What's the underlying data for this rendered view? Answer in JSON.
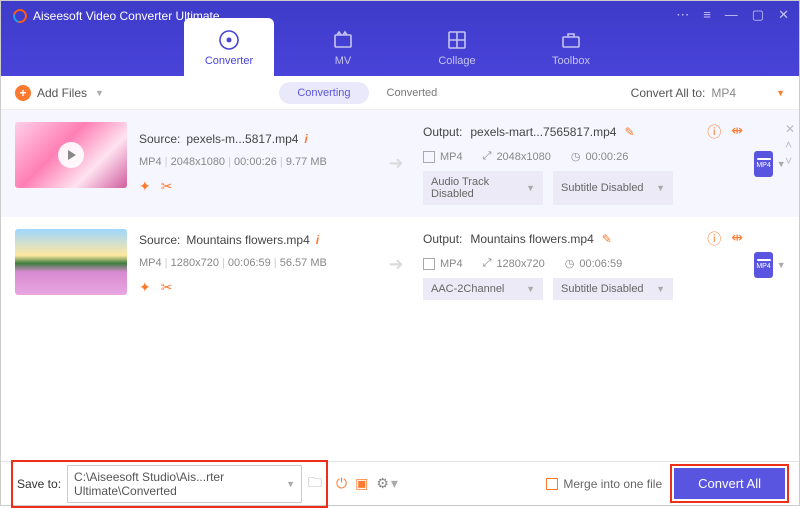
{
  "app": {
    "title": "Aiseesoft Video Converter Ultimate"
  },
  "topTabs": {
    "converter": "Converter",
    "mv": "MV",
    "collage": "Collage",
    "toolbox": "Toolbox"
  },
  "toolbar": {
    "addFiles": "Add Files",
    "seg": {
      "converting": "Converting",
      "converted": "Converted"
    },
    "convertAllToLabel": "Convert All to:",
    "convertAllToFormat": "MP4"
  },
  "items": [
    {
      "sourceLabel": "Source:",
      "sourceName": "pexels-m...5817.mp4",
      "format": "MP4",
      "resolution": "2048x1080",
      "duration": "00:00:26",
      "size": "9.77 MB",
      "outputLabel": "Output:",
      "outputName": "pexels-mart...7565817.mp4",
      "outFormat": "MP4",
      "outResolution": "2048x1080",
      "outDuration": "00:00:26",
      "audioTrack": "Audio Track Disabled",
      "subtitle": "Subtitle Disabled",
      "badge": "MP4"
    },
    {
      "sourceLabel": "Source:",
      "sourceName": "Mountains flowers.mp4",
      "format": "MP4",
      "resolution": "1280x720",
      "duration": "00:06:59",
      "size": "56.57 MB",
      "outputLabel": "Output:",
      "outputName": "Mountains flowers.mp4",
      "outFormat": "MP4",
      "outResolution": "1280x720",
      "outDuration": "00:06:59",
      "audioTrack": "AAC-2Channel",
      "subtitle": "Subtitle Disabled",
      "badge": "MP4"
    }
  ],
  "footer": {
    "saveToLabel": "Save to:",
    "savePath": "C:\\Aiseesoft Studio\\Ais...rter Ultimate\\Converted",
    "mergeLabel": "Merge into one file",
    "convertAll": "Convert All"
  }
}
